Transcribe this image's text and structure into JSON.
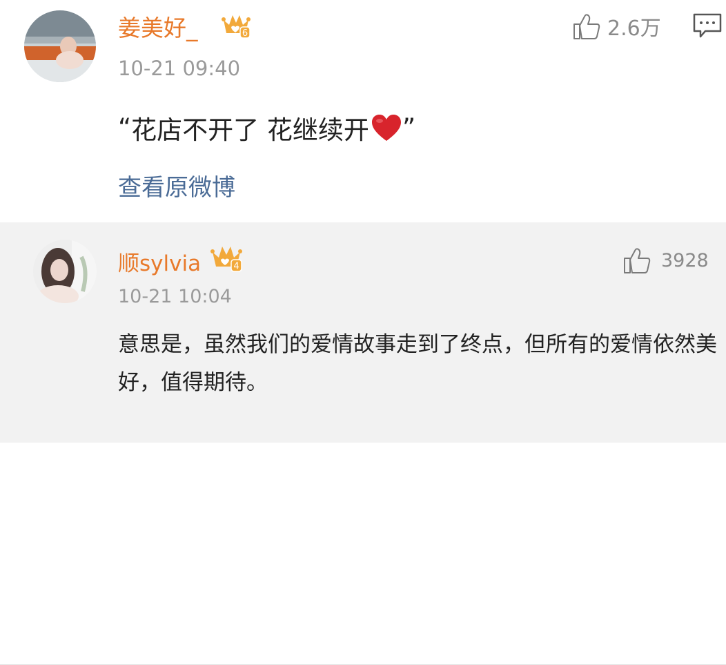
{
  "comments": [
    {
      "username": "姜美好_",
      "level": "6",
      "timestamp": "10-21 09:40",
      "likes": "2.6万",
      "quote_open": "“",
      "quote_text": "花店不开了 花继续开",
      "quote_close": "”",
      "view_original": "查看原微博"
    },
    {
      "username": "顺sylvia",
      "level": "4",
      "timestamp": "10-21 10:04",
      "likes": "3928",
      "text": "意思是，虽然我们的爱情故事走到了终点，但所有的爱情依然美好，值得期待。"
    }
  ],
  "colors": {
    "username": "#e8792a",
    "link": "#4a6b96",
    "meta": "#9a9a9a",
    "crown": "#f2a93b",
    "heart": "#d8242c"
  },
  "icons": [
    "crown-badge-icon",
    "thumbs-up-icon",
    "reply-comment-icon",
    "heart-emoji-icon"
  ]
}
